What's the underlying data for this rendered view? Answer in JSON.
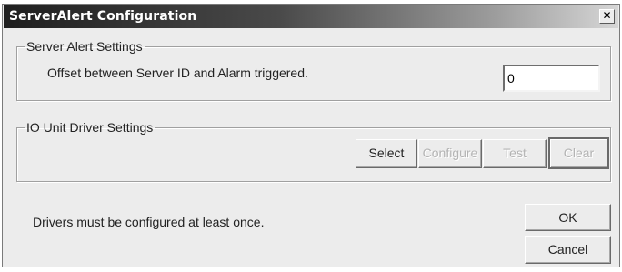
{
  "window": {
    "title": "ServerAlert Configuration",
    "close_glyph": "✕"
  },
  "server_alert": {
    "legend": "Server Alert Settings",
    "offset_label": "Offset between Server ID and Alarm triggered.",
    "offset_value": "0"
  },
  "io_unit": {
    "legend": "IO Unit Driver Settings",
    "buttons": {
      "select": "Select",
      "configure": "Configure",
      "test": "Test",
      "clear": "Clear"
    }
  },
  "footer": {
    "hint": "Drivers must be configured at least once.",
    "ok": "OK",
    "cancel": "Cancel"
  }
}
